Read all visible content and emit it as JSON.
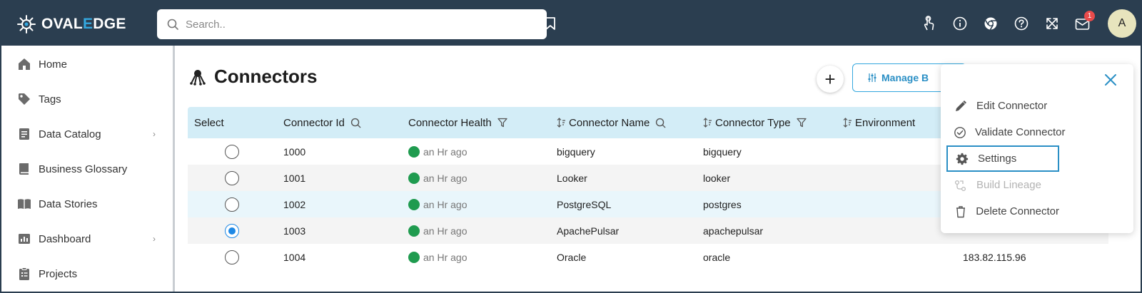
{
  "brand": {
    "name_part1": "OVAL",
    "name_part2": "E",
    "name_part3": "DGE"
  },
  "search": {
    "placeholder": "Search.."
  },
  "notifications": {
    "count": "1"
  },
  "user": {
    "avatar_letter": "A"
  },
  "sidebar": {
    "items": [
      {
        "label": "Home",
        "icon": "home-icon",
        "has_submenu": false
      },
      {
        "label": "Tags",
        "icon": "tag-icon",
        "has_submenu": false
      },
      {
        "label": "Data Catalog",
        "icon": "data-catalog-icon",
        "has_submenu": true
      },
      {
        "label": "Business Glossary",
        "icon": "book-icon",
        "has_submenu": false
      },
      {
        "label": "Data Stories",
        "icon": "open-book-icon",
        "has_submenu": false
      },
      {
        "label": "Dashboard",
        "icon": "dashboard-icon",
        "has_submenu": true
      },
      {
        "label": "Projects",
        "icon": "clipboard-icon",
        "has_submenu": false
      }
    ]
  },
  "page": {
    "title": "Connectors",
    "add_label": "+",
    "manage_label": "Manage B"
  },
  "table": {
    "columns": [
      {
        "label": "Select"
      },
      {
        "label": "Connector Id"
      },
      {
        "label": "Connector Health"
      },
      {
        "label": "Connector Name"
      },
      {
        "label": "Connector Type"
      },
      {
        "label": "Environment"
      }
    ],
    "rows": [
      {
        "id": "1000",
        "health": "an Hr ago",
        "name": "bigquery",
        "type": "bigquery",
        "extra": "",
        "selected": false
      },
      {
        "id": "1001",
        "health": "an Hr ago",
        "name": "Looker",
        "type": "looker",
        "extra": "",
        "selected": false
      },
      {
        "id": "1002",
        "health": "an Hr ago",
        "name": "PostgreSQL",
        "type": "postgres",
        "extra": "",
        "selected": false
      },
      {
        "id": "1003",
        "health": "an Hr ago",
        "name": "ApachePulsar",
        "type": "apachepulsar",
        "extra": "",
        "selected": true
      },
      {
        "id": "1004",
        "health": "an Hr ago",
        "name": "Oracle",
        "type": "oracle",
        "extra": "183.82.115.96",
        "selected": false
      }
    ]
  },
  "menu": {
    "items": [
      {
        "label": "Edit Connector",
        "icon": "pencil-icon",
        "disabled": false,
        "highlighted": false
      },
      {
        "label": "Validate Connector",
        "icon": "check-circle-icon",
        "disabled": false,
        "highlighted": false
      },
      {
        "label": "Settings",
        "icon": "gear-icon",
        "disabled": false,
        "highlighted": true
      },
      {
        "label": "Build Lineage",
        "icon": "lineage-icon",
        "disabled": true,
        "highlighted": false
      },
      {
        "label": "Delete Connector",
        "icon": "trash-icon",
        "disabled": false,
        "highlighted": false
      }
    ]
  },
  "colors": {
    "topbar": "#2b3e50",
    "accent": "#34a7de",
    "header_row": "#d3edf7",
    "health_ok": "#1f9b4f",
    "badge": "#e94b4b"
  }
}
